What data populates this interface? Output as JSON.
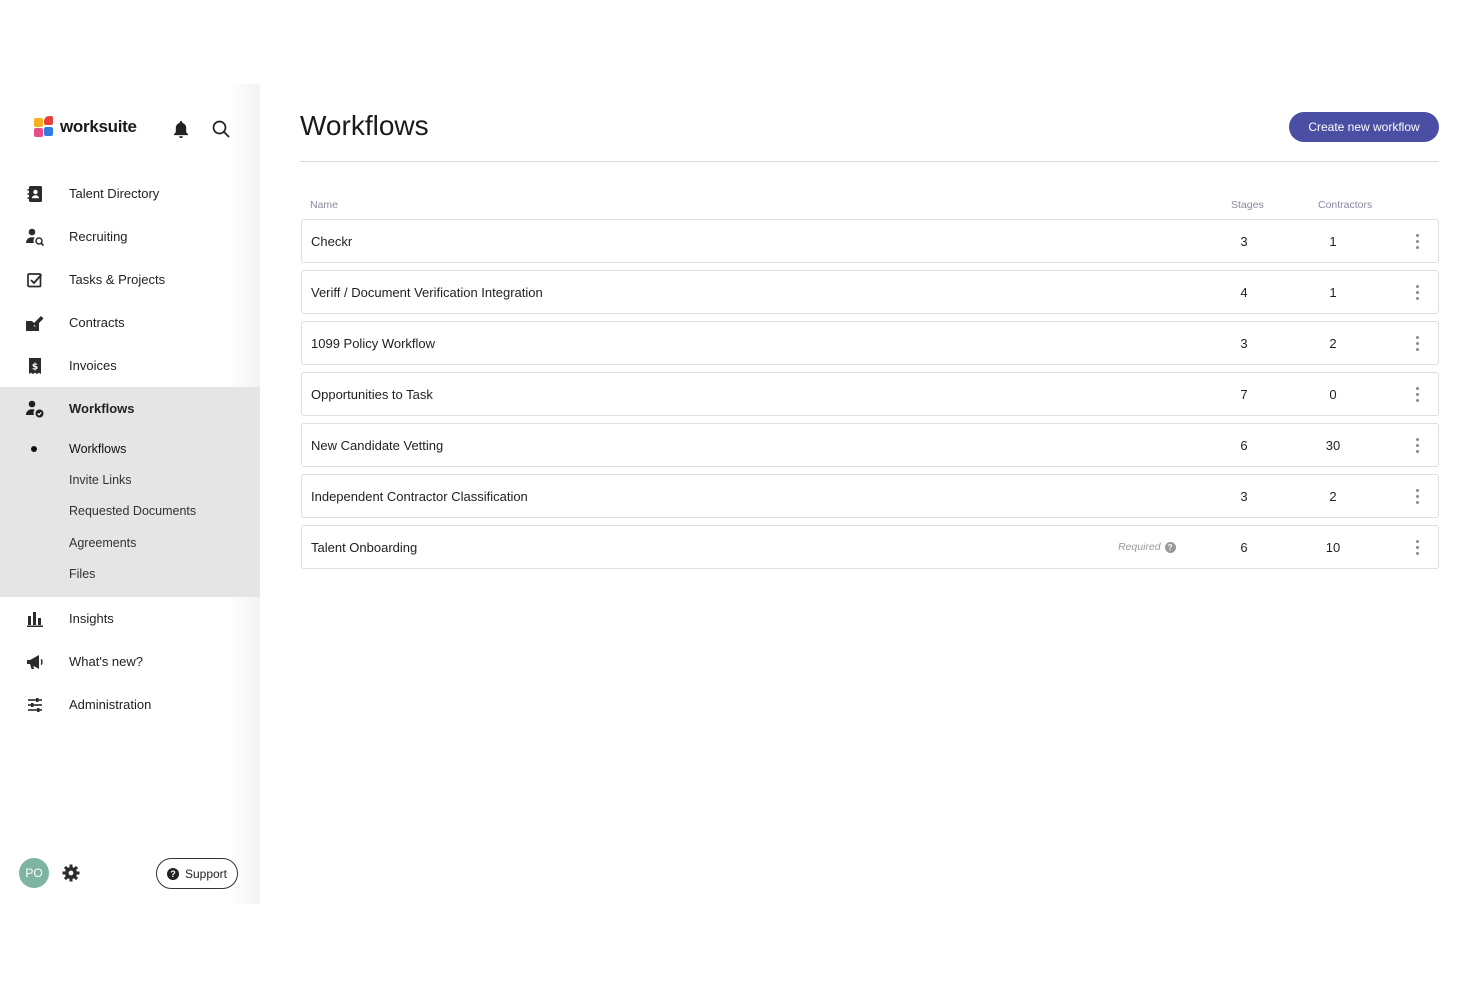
{
  "brand": {
    "name": "worksuite"
  },
  "colors": {
    "accent": "#4a4fa3",
    "avatar": "#7fb3a3",
    "active_group_bg": "#e5e5e5"
  },
  "header_icons": [
    {
      "icon": "bell-icon"
    },
    {
      "icon": "search-icon"
    }
  ],
  "sidebar": {
    "items": [
      {
        "label": "Talent Directory",
        "icon": "contact-book-icon"
      },
      {
        "label": "Recruiting",
        "icon": "person-search-icon"
      },
      {
        "label": "Tasks & Projects",
        "icon": "checkbox-icon"
      },
      {
        "label": "Contracts",
        "icon": "signed-contract-icon"
      },
      {
        "label": "Invoices",
        "icon": "dollar-receipt-icon"
      }
    ],
    "active_group": {
      "label": "Workflows",
      "icon": "person-check-icon",
      "sub_items": [
        {
          "label": "Workflows",
          "active": true
        },
        {
          "label": "Invite Links"
        },
        {
          "label": "Requested Documents"
        },
        {
          "label": "Agreements"
        },
        {
          "label": "Files"
        }
      ]
    },
    "items_after": [
      {
        "label": "Insights",
        "icon": "bar-chart-icon"
      },
      {
        "label": "What's new?",
        "icon": "megaphone-icon"
      },
      {
        "label": "Administration",
        "icon": "sliders-icon"
      }
    ],
    "footer": {
      "avatar_initials": "PO",
      "support_label": "Support"
    }
  },
  "main": {
    "title": "Workflows",
    "create_button": "Create new workflow",
    "columns": {
      "name": "Name",
      "stages": "Stages",
      "contractors": "Contractors"
    },
    "rows": [
      {
        "name": "Checkr",
        "required": "",
        "stages": "3",
        "contractors": "1"
      },
      {
        "name": "Veriff / Document Verification Integration",
        "required": "",
        "stages": "4",
        "contractors": "1"
      },
      {
        "name": "1099 Policy Workflow",
        "required": "",
        "stages": "3",
        "contractors": "2"
      },
      {
        "name": "Opportunities to Task",
        "required": "",
        "stages": "7",
        "contractors": "0"
      },
      {
        "name": "New Candidate Vetting",
        "required": "",
        "stages": "6",
        "contractors": "30"
      },
      {
        "name": "Independent Contractor Classification",
        "required": "",
        "stages": "3",
        "contractors": "2"
      },
      {
        "name": "Talent Onboarding",
        "required": "Required",
        "stages": "6",
        "contractors": "10"
      }
    ]
  }
}
